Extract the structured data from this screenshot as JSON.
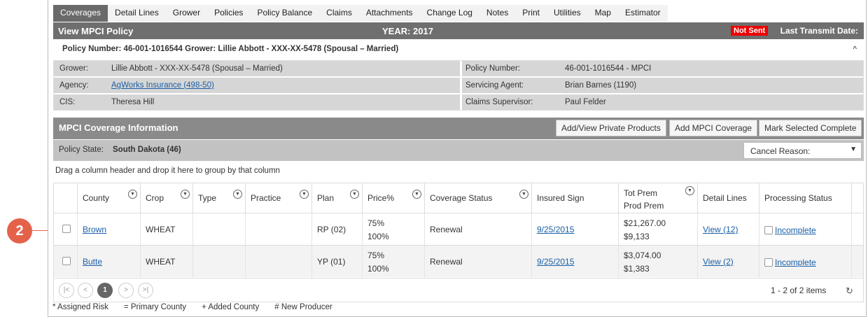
{
  "tabs": [
    "Coverages",
    "Detail Lines",
    "Grower",
    "Policies",
    "Policy Balance",
    "Claims",
    "Attachments",
    "Change Log",
    "Notes",
    "Print",
    "Utilities",
    "Map",
    "Estimator"
  ],
  "title_bar": {
    "title": "View MPCI Policy",
    "year": "YEAR: 2017",
    "status": "Not Sent",
    "transmit": "Last Transmit Date:"
  },
  "summary": {
    "text": "Policy Number: 46-001-1016544 Grower: Lillie Abbott - XXX-XX-5478 (Spousal – Married)",
    "toggle": "^"
  },
  "info": {
    "grower_label": "Grower:",
    "grower": "Lillie Abbott - XXX-XX-5478 (Spousal – Married)",
    "agency_label": "Agency:",
    "agency": "AgWorks Insurance (498-50)",
    "cis_label": "CIS:",
    "cis": "Theresa Hill",
    "policy_label": "Policy Number:",
    "policy": "46-001-1016544 - MPCI",
    "agent_label": "Servicing Agent:",
    "agent": "Brian Barnes (1190)",
    "claims_label": "Claims Supervisor:",
    "claims": "Paul Felder"
  },
  "coverage": {
    "title": "MPCI Coverage Information",
    "btn_private": "Add/View Private Products",
    "btn_add": "Add MPCI Coverage",
    "btn_mark": "Mark Selected Complete"
  },
  "state": {
    "label": "Policy State:",
    "value": "South Dakota (46)",
    "cancel": "Cancel Reason:"
  },
  "group_hint": "Drag a column header and drop it here to group by that column",
  "columns": {
    "county": "County",
    "crop": "Crop",
    "type": "Type",
    "practice": "Practice",
    "plan": "Plan",
    "price": "Price%",
    "coverage_status": "Coverage Status",
    "insured_sign": "Insured Sign",
    "tot_prem": "Tot Prem",
    "prod_prem": "Prod Prem",
    "detail_lines": "Detail Lines",
    "processing": "Processing Status"
  },
  "rows": [
    {
      "county": "Brown",
      "crop": "WHEAT",
      "plan": "RP (02)",
      "price1": "75%",
      "price2": "100%",
      "status": "Renewal",
      "sign": "9/25/2015",
      "tot": "$21,267.00",
      "prod": "$9,133",
      "detail": "View (12)",
      "processing": "Incomplete"
    },
    {
      "county": "Butte",
      "crop": "WHEAT",
      "plan": "YP (01)",
      "price1": "75%",
      "price2": "100%",
      "status": "Renewal",
      "sign": "9/25/2015",
      "tot": "$3,074.00",
      "prod": "$1,383",
      "detail": "View (2)",
      "processing": "Incomplete"
    }
  ],
  "pager": {
    "page": "1",
    "info": "1 - 2 of 2 items"
  },
  "legend": [
    "* Assigned Risk",
    "= Primary County",
    "+ Added County",
    "# New Producer"
  ],
  "marker": "2"
}
